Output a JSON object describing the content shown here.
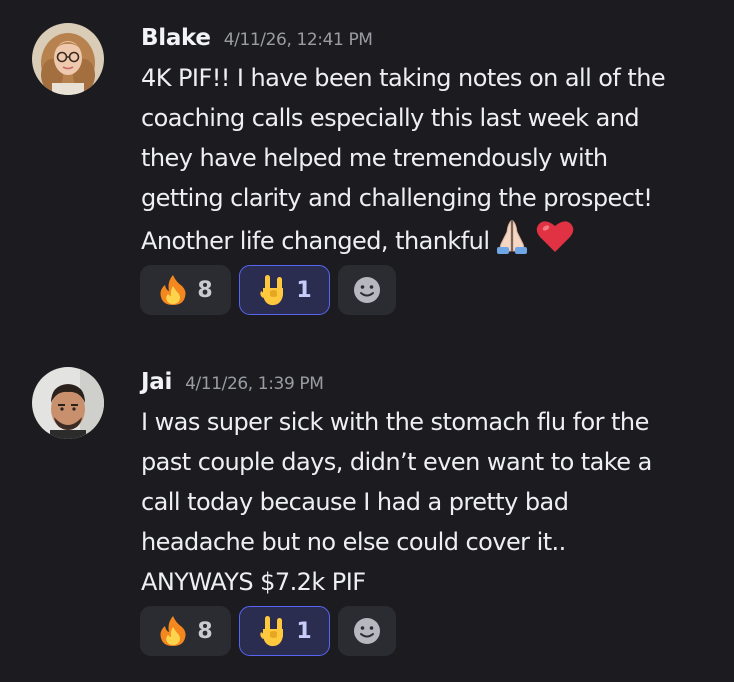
{
  "messages": [
    {
      "username": "Blake",
      "timestamp": "4/11/26, 12:41 PM",
      "avatar_icon": "avatar-blake",
      "lines": [
        "4K PIF!! I have been taking notes on all of the",
        "coaching calls especially this last week and",
        "they have helped me tremendously with",
        "getting clarity and challenging the prospect!",
        "Another life changed, thankful"
      ],
      "trailing_emojis": [
        "folded-hands-icon",
        "red-heart-icon"
      ],
      "reactions": [
        {
          "icon": "fire-icon",
          "count": "8",
          "selected": false
        },
        {
          "icon": "sign-of-horns-icon",
          "count": "1",
          "selected": true
        }
      ],
      "add_reaction_icon": "add-reaction-icon"
    },
    {
      "username": "Jai",
      "timestamp": "4/11/26, 1:39 PM",
      "avatar_icon": "avatar-jai",
      "lines": [
        "I was super sick with the stomach flu for the",
        "past couple days, didn’t even want to take a",
        "call today because I had a pretty bad",
        "headache but no else could cover it..",
        "ANYWAYS $7.2k PIF"
      ],
      "reactions": [
        {
          "icon": "fire-icon",
          "count": "8",
          "selected": false
        },
        {
          "icon": "sign-of-horns-icon",
          "count": "1",
          "selected": true
        }
      ],
      "add_reaction_icon": "add-reaction-icon"
    }
  ],
  "colors": {
    "background": "#1c1c20",
    "reaction_bg": "#2b2c32",
    "reaction_selected_bg": "#2a2d50",
    "reaction_selected_border": "#5865f2",
    "text": "#eeeff2",
    "timestamp": "#9a9ca4"
  }
}
